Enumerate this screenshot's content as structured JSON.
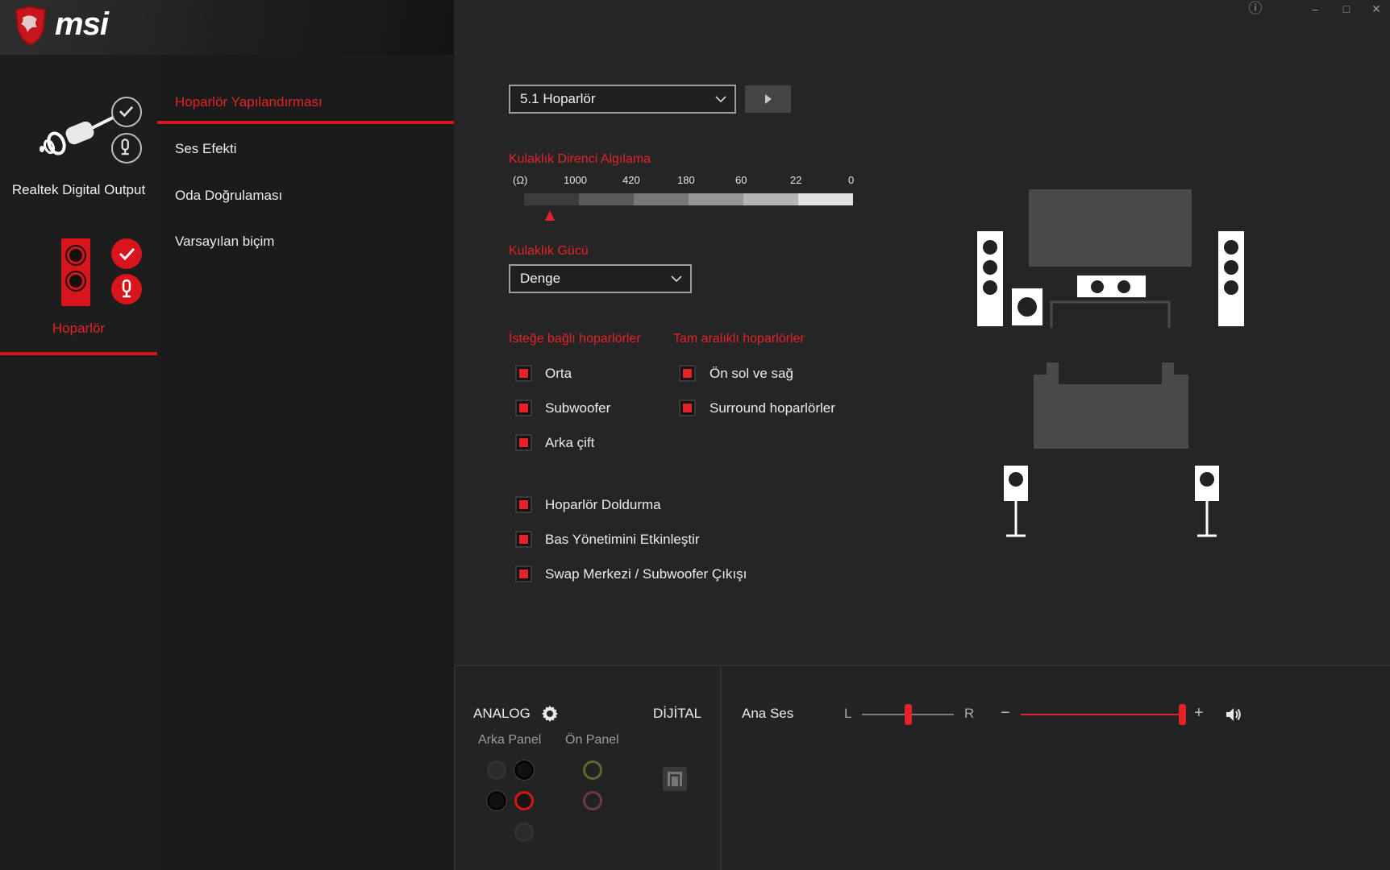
{
  "app": {
    "brand": "msi"
  },
  "devices": [
    {
      "name": "Realtek Digital Output",
      "selected": false
    },
    {
      "name": "Hoparlör",
      "selected": true
    }
  ],
  "nav": {
    "items": [
      {
        "label": "Hoparlör Yapılandırması",
        "active": true
      },
      {
        "label": "Ses Efekti",
        "active": false
      },
      {
        "label": "Oda Doğrulaması",
        "active": false
      },
      {
        "label": "Varsayılan biçim",
        "active": false
      }
    ]
  },
  "window_controls": {
    "info": "ⓘ",
    "minimize": "–",
    "maximize": "□",
    "close": "✕"
  },
  "speaker_config": {
    "selected": "5.1 Hoparlör"
  },
  "headphone_impedance": {
    "title": "Kulaklık Direnci Algılama",
    "unit": "(Ω)",
    "ticks": [
      "1000",
      "420",
      "180",
      "60",
      "22",
      "0"
    ],
    "segment_colors": [
      "#3c3c3c",
      "#5a5a5a",
      "#787878",
      "#969696",
      "#b4b4b4",
      "#e0e0e0"
    ],
    "marker_segment_index": 0
  },
  "headphone_power": {
    "title": "Kulaklık Gücü",
    "selected": "Denge"
  },
  "optional_speakers": {
    "title": "İsteğe bağlı hoparlörler",
    "items": [
      {
        "label": "Orta",
        "checked": true
      },
      {
        "label": "Subwoofer",
        "checked": true
      },
      {
        "label": "Arka çift",
        "checked": true
      }
    ]
  },
  "full_range_speakers": {
    "title": "Tam aralıklı hoparlörler",
    "items": [
      {
        "label": "Ön sol ve sağ",
        "checked": true
      },
      {
        "label": "Surround hoparlörler",
        "checked": true
      }
    ]
  },
  "extra_options": [
    {
      "label": "Hoparlör Doldurma",
      "checked": true
    },
    {
      "label": "Bas Yönetimini Etkinleştir",
      "checked": true
    },
    {
      "label": "Swap Merkezi / Subwoofer Çıkışı",
      "checked": true
    }
  ],
  "bottom": {
    "analog_label": "ANALOG",
    "digital_label": "DİJİTAL",
    "rear_panel_label": "Arka Panel",
    "front_panel_label": "Ön Panel",
    "master_volume_label": "Ana Ses",
    "balance_left": "L",
    "balance_right": "R",
    "volume_minus": "−",
    "volume_plus": "+",
    "balance_value": 0.5,
    "volume_value": 1.0
  },
  "colors": {
    "accent": "#e5222a",
    "jack_green": "#5a6a2a",
    "jack_pink": "#6b3b48"
  }
}
